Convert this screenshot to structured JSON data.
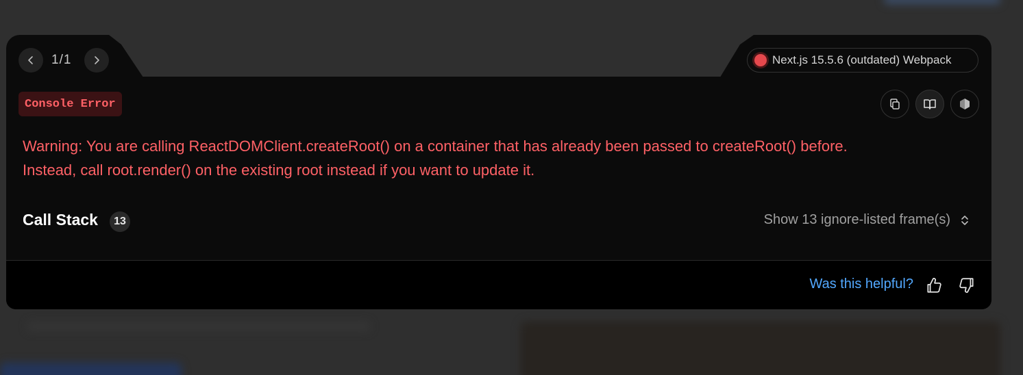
{
  "nav": {
    "prev_icon": "chevron-left-icon",
    "next_icon": "chevron-right-icon",
    "pager_text": "1/1"
  },
  "version": {
    "status_color": "#e5484d",
    "label": "Next.js 15.5.6 (outdated) Webpack"
  },
  "error": {
    "badge": "Console Error",
    "message_line1": "Warning: You are calling ReactDOMClient.createRoot() on a container that has already been passed to createRoot() before.",
    "message_line2": "Instead, call root.render() on the existing root instead if you want to update it.",
    "color": "#ff6166"
  },
  "actions": [
    {
      "icon": "copy-icon"
    },
    {
      "icon": "docs-book-icon"
    },
    {
      "icon": "nodejs-hexagon-icon"
    }
  ],
  "call_stack": {
    "title": "Call Stack",
    "count": "13",
    "toggle_label": "Show 13 ignore-listed frame(s)",
    "toggle_icon": "chevron-up-down-icon"
  },
  "footer": {
    "helpful_label": "Was this helpful?",
    "helpful_color": "#52a8ff",
    "thumbs_up_icon": "thumbs-up-icon",
    "thumbs_down_icon": "thumbs-down-icon"
  }
}
